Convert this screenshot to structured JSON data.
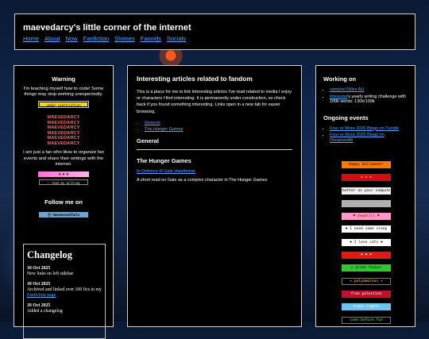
{
  "header": {
    "title": "maevedarcy's little corner of the internet",
    "nav": [
      "Home",
      "About",
      "Now",
      "Fanfiction",
      "Shrines",
      "Fanvids",
      "Socials"
    ]
  },
  "left": {
    "warning_heading": "Warning",
    "warning_text": "I'm teaching myself how to code! Some things may stop working unexpectedly.",
    "stamp_construction": "under construction",
    "logo_rows": [
      "MAEVEDARCY  MAEVEDARCY",
      "MAEVEDARCY  MAEVEDARCY",
      "MAEVEDARCY  MAEVEDARCY"
    ],
    "fan_text": "I am just a fan who likes to organize fan events and share their writings with the internet.",
    "stamp_pink": "♥ ♥ ♥",
    "stamp_reading": "☉ read my writing",
    "follow_heading": "Follow me on",
    "stamp_handle": "⦿ heavencenthalo",
    "changelog": {
      "title": "Changelog",
      "entries": [
        {
          "date": "18 Oct 2025",
          "text": "New links on left sidebar"
        },
        {
          "date": "18 Oct 2025",
          "text_before": "Archived and linked over 100 fics to my ",
          "link": "Fanfiction page",
          "text_after": ""
        },
        {
          "date": "18 Oct 2025",
          "text": "Added a changelog"
        }
      ]
    }
  },
  "main": {
    "title": "Interesting articles related to fandom",
    "intro": "This is a place for me to link interesting articles I've read related to media I enjoy or characters I find interesting. It is permanently under construction, so check back if you found something interesting. Links open in a new tab for easier browsing.",
    "toc": [
      "General",
      "The Hunger Games"
    ],
    "section_general": "General",
    "section_thg": "The Hunger Games",
    "article_link": "In Defence of Gale Hawthorne",
    "article_desc": "A short read on Gale as a complex character in The Hunger Games"
  },
  "right": {
    "working_heading": "Working on",
    "working_items": [
      {
        "link": "vampire!Stiles AU",
        "rest": ""
      },
      {
        "link": "interestw",
        "rest": "'s yearly writing challenge with 100k words: 130k/100k"
      }
    ],
    "events_heading": "Ongoing events",
    "events": [
      "Four or More 2025 Bingo on Tumblr",
      "Four or More 2025 Bingo on Dreamwidth"
    ],
    "stamps": [
      {
        "label": "Happy Halloween!",
        "bg": "#ff7a00",
        "fg": "#000000"
      },
      {
        "label": "☠ ☠ ☠",
        "bg": "#d01010",
        "fg": "#ffffff"
      },
      {
        "label": "better on your computer ▣",
        "bg": "#f2f2f2",
        "fg": "#000000"
      },
      {
        "label": "",
        "bg": "#b0b0b0",
        "fg": "#000000"
      },
      {
        "label": "♥ dewdrill ♥",
        "bg": "#ff9ac8",
        "fg": "#c00000"
      },
      {
        "label": "❤ I need some sleep",
        "bg": "#ffffff",
        "fg": "#000000"
      },
      {
        "label": "❤ I love cats ❤",
        "bg": "#ffffff",
        "fg": "#000000"
      },
      {
        "label": "⚑ ⚑ ⚑",
        "bg": "#e01818",
        "fg": "#ffffff"
      },
      {
        "label": "☠ alien fucker",
        "bg": "#2ec92e",
        "fg": "#000000"
      },
      {
        "label": "✦ polyamorous ✦",
        "bg": "#000000",
        "fg": "#ffcc33"
      },
      {
        "label": "free palestine",
        "bg": "#c0102a",
        "fg": "#ffffff"
      },
      {
        "label": "trans rights",
        "bg": "#6fc3ef",
        "fg": "#ffffff"
      },
      {
        "label": "code before fun",
        "bg": "#000000",
        "fg": "#4cff4c"
      }
    ]
  }
}
